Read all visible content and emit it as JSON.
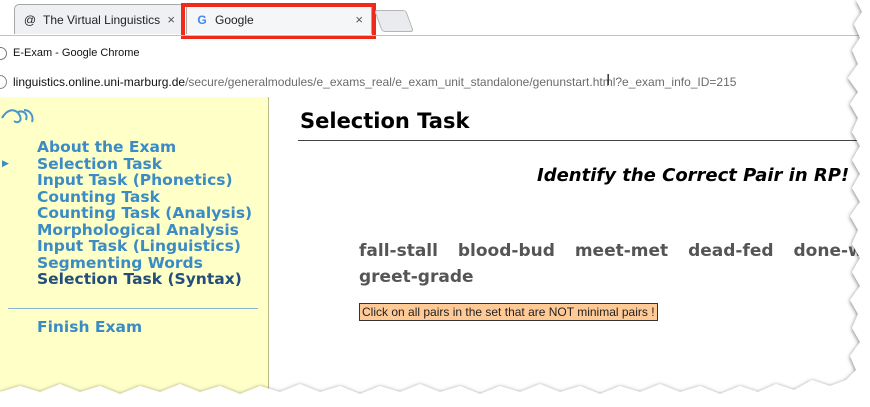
{
  "tabs": [
    {
      "title": "The Virtual Linguistics Ca",
      "icon": "at-sign-icon",
      "close": "×"
    },
    {
      "title": "Google",
      "icon": "google-g-icon",
      "close": "×"
    }
  ],
  "window_title": "E-Exam - Google Chrome",
  "address_bar": {
    "host": "linguistics.online.uni-marburg.de",
    "path": "/secure/generalmodules/e_exams_real/e_exam_unit_standalone/genunstart.html?e_exam_info_ID=215"
  },
  "sidebar": {
    "items": [
      {
        "label": "About the Exam"
      },
      {
        "label": "Selection Task"
      },
      {
        "label": "Input Task (Phonetics)"
      },
      {
        "label": "Counting Task"
      },
      {
        "label": "Counting Task (Analysis)"
      },
      {
        "label": "Morphological Analysis"
      },
      {
        "label": "Input Task (Linguistics)"
      },
      {
        "label": "Segmenting Words"
      },
      {
        "label": "Selection Task (Syntax)"
      }
    ],
    "finish": "Finish Exam"
  },
  "main": {
    "title": "Selection Task",
    "instruction": "Identify the Correct Pair in RP!",
    "pairs": [
      "fall-stall",
      "blood-bud",
      "meet-met",
      "dead-fed",
      "done-won",
      "greet-grade"
    ],
    "hint": "Click on all pairs in the set that are NOT minimal pairs !"
  },
  "colors": {
    "highlight": "#f02a1a",
    "sidebar_bg": "#ffffc8",
    "nav_link": "#3b8bc4",
    "hint_bg": "#ffca95"
  }
}
